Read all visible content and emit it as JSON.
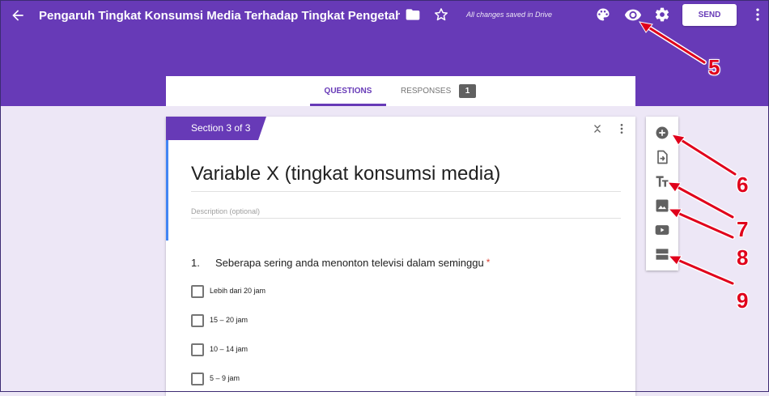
{
  "header": {
    "title": "Pengaruh Tingkat Konsumsi Media Terhadap Tingkat Pengetahuan",
    "saved_status": "All changes saved in Drive",
    "send_label": "SEND",
    "icons": [
      "back-arrow-icon",
      "folder-icon",
      "star-icon",
      "palette-icon",
      "eye-icon",
      "gear-icon",
      "more-vert-icon"
    ],
    "color": "#673ab7"
  },
  "tabs": {
    "questions": "QUESTIONS",
    "responses": "RESPONSES",
    "responses_count": "1"
  },
  "section": {
    "label": "Section 3 of 3",
    "title": "Variable X (tingkat konsumsi media)",
    "description_placeholder": "Description (optional)"
  },
  "question": {
    "number": "1.",
    "text": "Seberapa sering anda menonton televisi dalam seminggu",
    "required_mark": "*",
    "options": [
      "Lebih dari 20 jam",
      "15 – 20 jam",
      "10 – 14 jam",
      "5 – 9 jam"
    ]
  },
  "toolbar": {
    "icons": [
      "add-question-icon",
      "import-questions-icon",
      "add-title-icon",
      "add-image-icon",
      "add-video-icon",
      "add-section-icon"
    ]
  },
  "annotations": {
    "callout_5": "5",
    "callout_6": "6",
    "callout_7": "7",
    "callout_8": "8",
    "callout_9": "9",
    "color": "#e0001b"
  }
}
